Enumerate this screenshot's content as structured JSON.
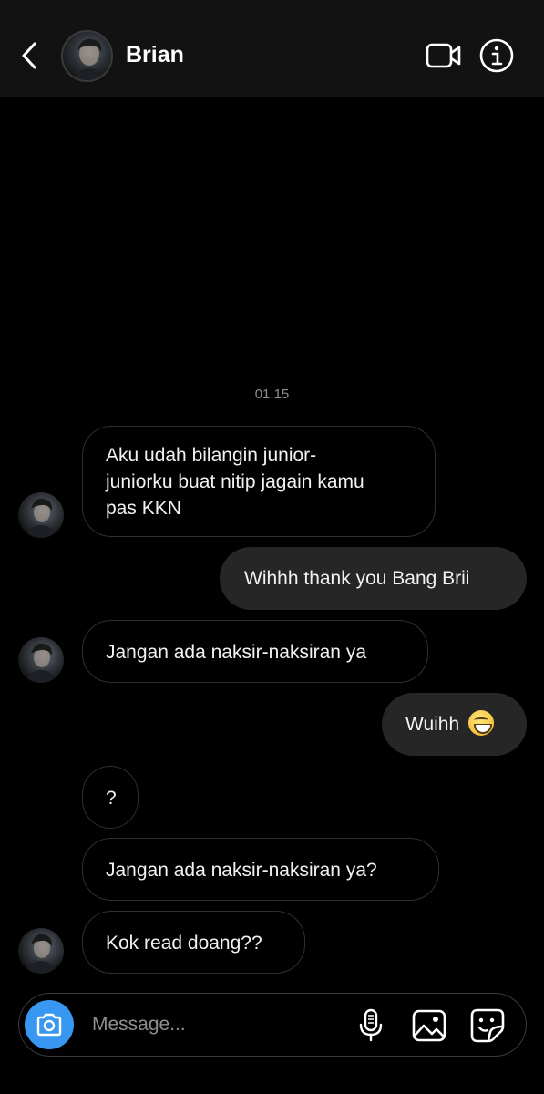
{
  "header": {
    "contact_name": "Brian",
    "icons": {
      "back": "chevron-left-icon",
      "video": "video-camera-icon",
      "info": "info-icon"
    }
  },
  "conversation": {
    "timestamp": "01.15",
    "messages": [
      {
        "direction": "incoming",
        "text_lines": [
          "Aku udah bilangin junior-",
          "juniorku buat nitip jagain kamu",
          "pas KKN"
        ]
      },
      {
        "direction": "outgoing",
        "text": "Wihhh thank you Bang Brii"
      },
      {
        "direction": "incoming",
        "text": "Jangan ada naksir-naksiran ya"
      },
      {
        "direction": "outgoing",
        "text": "Wuihh",
        "emoji": "grinning-face-emoji"
      },
      {
        "direction": "incoming",
        "text": "?"
      },
      {
        "direction": "incoming",
        "text": "Jangan ada naksir-naksiran ya?"
      },
      {
        "direction": "incoming",
        "text": "Kok read doang??"
      }
    ]
  },
  "composer": {
    "placeholder": "Message...",
    "value": "",
    "icons": {
      "camera": "camera-icon",
      "mic": "microphone-icon",
      "gallery": "image-icon",
      "sticker": "sticker-icon"
    },
    "accent_color": "#3897f0"
  },
  "colors": {
    "background": "#000000",
    "header_bg": "#121212",
    "outgoing_bubble": "#262626",
    "incoming_border": "#2f2f2f",
    "timestamp": "#8e8e8e"
  }
}
